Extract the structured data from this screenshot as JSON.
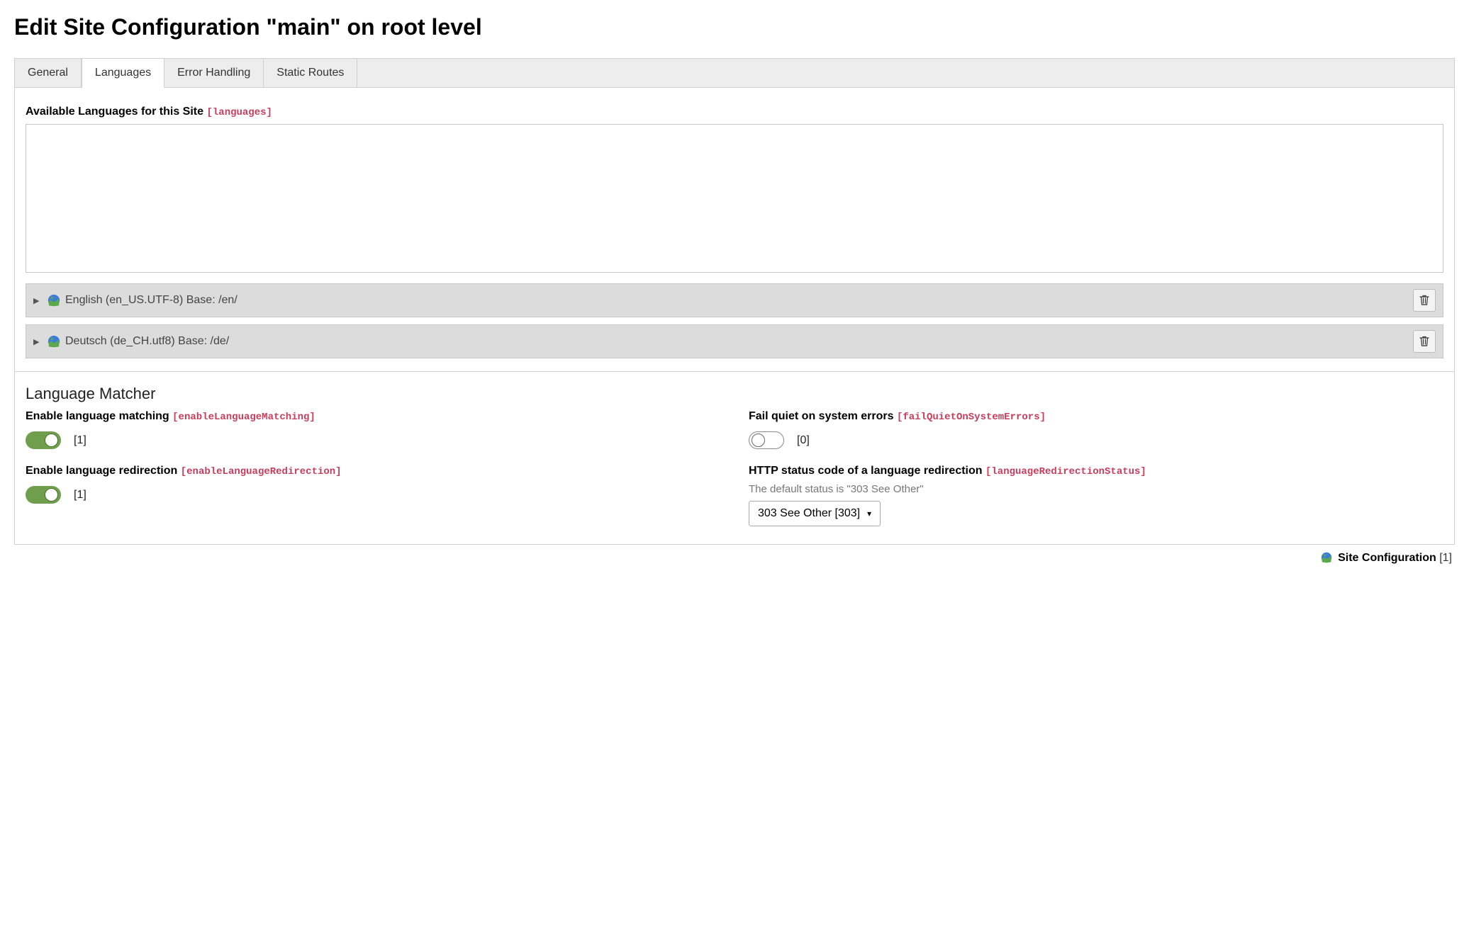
{
  "page_title": "Edit Site Configuration \"main\" on root level",
  "tabs": [
    {
      "label": "General",
      "active": false
    },
    {
      "label": "Languages",
      "active": true
    },
    {
      "label": "Error Handling",
      "active": false
    },
    {
      "label": "Static Routes",
      "active": false
    }
  ],
  "available_languages": {
    "label": "Available Languages for this Site",
    "tech": "[languages]"
  },
  "language_entries": [
    {
      "text": "English (en_US.UTF-8) Base: /en/"
    },
    {
      "text": "Deutsch (de_CH.utf8) Base: /de/"
    }
  ],
  "matcher": {
    "heading": "Language Matcher",
    "enable_matching": {
      "label": "Enable language matching",
      "tech": "[enableLanguageMatching]",
      "value": "[1]",
      "on": true
    },
    "fail_quiet": {
      "label": "Fail quiet on system errors",
      "tech": "[failQuietOnSystemErrors]",
      "value": "[0]",
      "on": false
    },
    "enable_redirection": {
      "label": "Enable language redirection",
      "tech": "[enableLanguageRedirection]",
      "value": "[1]",
      "on": true
    },
    "redirection_status": {
      "label": "HTTP status code of a language redirection",
      "tech": "[languageRedirectionStatus]",
      "help": "The default status is \"303 See Other\"",
      "selected": "303 See Other [303]"
    }
  },
  "footer": {
    "label": "Site Configuration",
    "index": "[1]"
  }
}
